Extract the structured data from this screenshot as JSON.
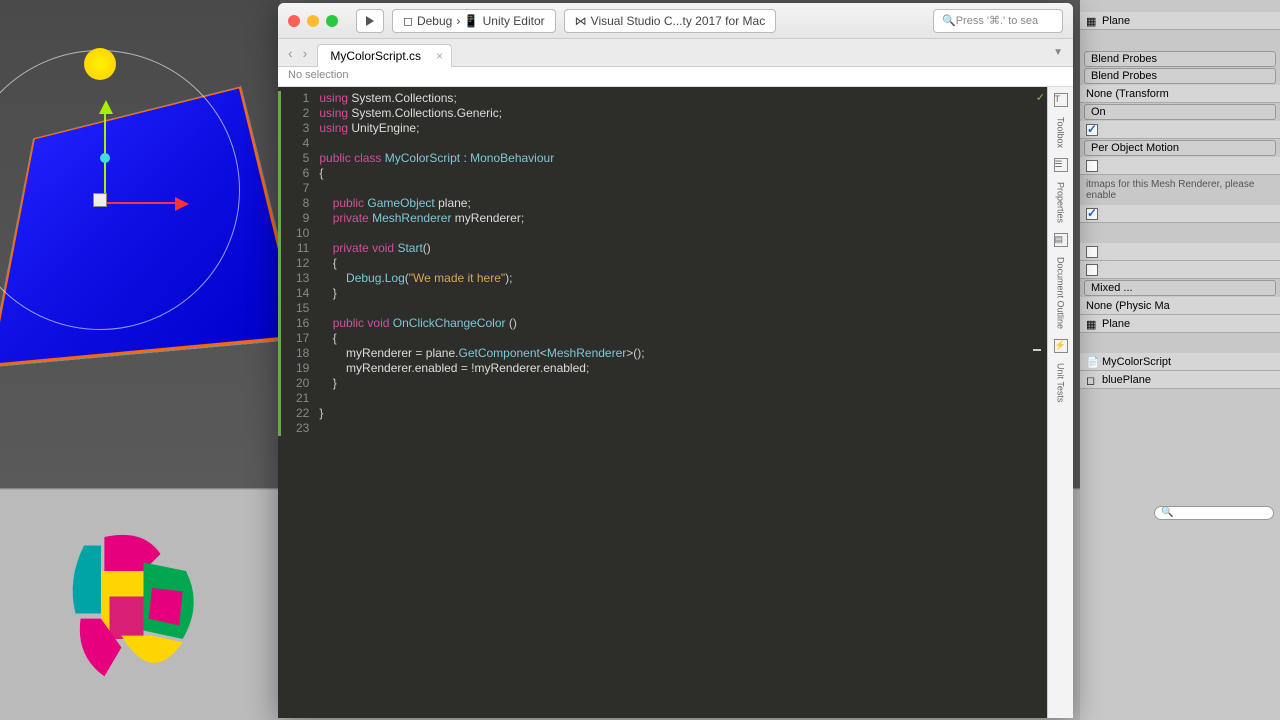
{
  "titlebar": {
    "debug": "Debug",
    "target": "Unity Editor",
    "app": "Visual Studio C...ty 2017 for Mac",
    "search_placeholder": "Press '⌘.' to sea"
  },
  "tabs": {
    "file": "MyColorScript.cs",
    "breadcrumb": "No selection"
  },
  "sidebar": {
    "toolbox": "Toolbox",
    "properties": "Properties",
    "outline": "Document Outline",
    "tests": "Unit Tests"
  },
  "code": {
    "lines": [
      "1",
      "2",
      "3",
      "4",
      "5",
      "6",
      "7",
      "8",
      "9",
      "10",
      "11",
      "12",
      "13",
      "14",
      "15",
      "16",
      "17",
      "18",
      "19",
      "20",
      "21",
      "22",
      "23"
    ],
    "l1_using": "using",
    "l1_ns": "System.Collections",
    "l2_using": "using",
    "l2_ns": "System.Collections.Generic",
    "l3_using": "using",
    "l3_ns": "UnityEngine",
    "l5_pub": "public",
    "l5_class": "class",
    "l5_name": "MyColorScript",
    "l5_base": "MonoBehaviour",
    "l8_pub": "public",
    "l8_type": "GameObject",
    "l8_name": "plane",
    "l9_priv": "private",
    "l9_type": "MeshRenderer",
    "l9_name": "myRenderer",
    "l11_priv": "private",
    "l11_void": "void",
    "l11_name": "Start",
    "l13_obj": "Debug",
    "l13_mth": "Log",
    "l13_str": "\"We made it here\"",
    "l16_pub": "public",
    "l16_void": "void",
    "l16_name": "OnClickChangeColor",
    "l18_lhs": "myRenderer",
    "l18_rhs": "plane",
    "l18_mth": "GetComponent",
    "l18_gen": "MeshRenderer",
    "l19_lhs": "myRenderer",
    "l19_prop": "enabled",
    "l19_rhs": "myRenderer",
    "l19_prop2": "enabled"
  },
  "inspector": {
    "plane": "Plane",
    "blend1": "Blend Probes",
    "blend2": "Blend Probes",
    "anchor": "None (Transform",
    "on": "On",
    "motion": "Per Object Motion",
    "note": "itmaps for this Mesh Renderer, please enable",
    "mixed": "Mixed ...",
    "physic": "None (Physic Ma",
    "plane2": "Plane",
    "script": "MyColorScript",
    "blueplane": "bluePlane"
  }
}
